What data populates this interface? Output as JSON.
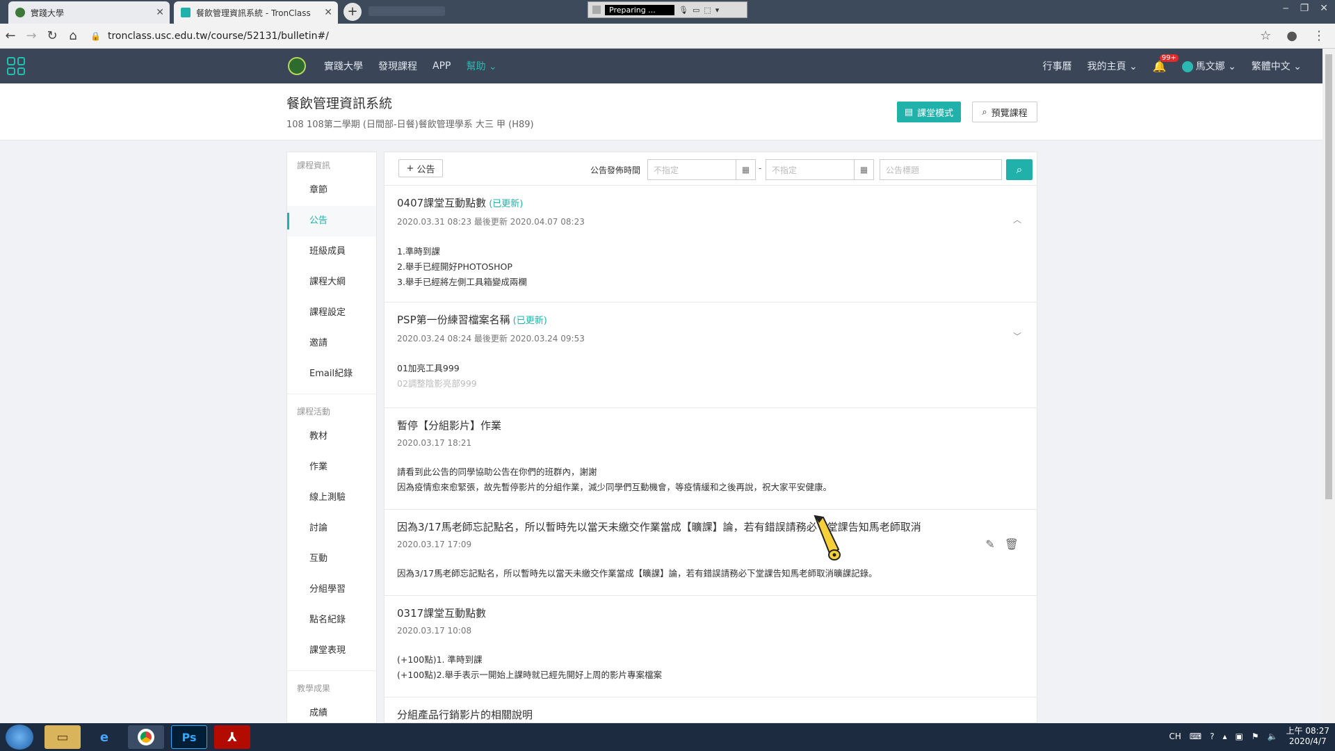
{
  "browser": {
    "tabs": [
      {
        "label": "實踐大學"
      },
      {
        "label": "餐飲管理資訊系統 - TronClass"
      }
    ],
    "recorder_status": "Preparing ...",
    "url": "tronclass.usc.edu.tw/course/52131/bulletin#/"
  },
  "header": {
    "nav": [
      "實踐大學",
      "發現課程",
      "APP",
      "幫助"
    ],
    "right": {
      "calendar": "行事曆",
      "my_home": "我的主頁",
      "notif_count": "99+",
      "user": "馬文娜",
      "language": "繁體中文"
    }
  },
  "course": {
    "title": "餐飲管理資訊系統",
    "subtitle": "108 108第二學期 (日間部-日餐)餐飲管理學系 大三 甲 (H89)",
    "btn_classroom": "課堂模式",
    "btn_preview": "預覽課程"
  },
  "sidebar": {
    "sections": [
      {
        "title": "課程資訊",
        "items": [
          "章節",
          "公告",
          "班級成員",
          "課程大綱",
          "課程設定",
          "邀請",
          "Email紀錄"
        ]
      },
      {
        "title": "課程活動",
        "items": [
          "教材",
          "作業",
          "線上測驗",
          "討論",
          "互動",
          "分組學習",
          "點名紀錄",
          "課堂表現"
        ]
      },
      {
        "title": "教學成果",
        "items": [
          "成績"
        ]
      }
    ],
    "active": "公告"
  },
  "toolbar": {
    "add_label": "公告",
    "filter_label": "公告發佈時間",
    "date_from_placeholder": "不指定",
    "date_to_placeholder": "不指定",
    "title_placeholder": "公告標題"
  },
  "posts": [
    {
      "title": "0407課堂互動點數",
      "updated": "(已更新)",
      "meta": "2020.03.31 08:23 最後更新 2020.04.07 08:23",
      "body": [
        "1.準時到課",
        "2.舉手已經開好PHOTOSHOP",
        "3.舉手已經將左側工具箱變成兩欄"
      ]
    },
    {
      "title": "PSP第一份練習檔案名稱",
      "updated": "(已更新)",
      "meta": "2020.03.24 08:24 最後更新 2020.03.24 09:53",
      "body": [
        "01加亮工具999",
        "02調整陰影亮部999"
      ]
    },
    {
      "title": "暫停【分組影片】作業",
      "updated": "",
      "meta": "2020.03.17 18:21",
      "body": [
        "請看到此公告的同學協助公告在你們的班群內，謝謝",
        "因為疫情愈來愈緊張，故先暫停影片的分組作業，減少同學們互動機會，等疫情緩和之後再說，祝大家平安健康。"
      ]
    },
    {
      "title": "因為3/17馬老師忘記點名，所以暫時先以當天未繳交作業當成【曠課】論，若有錯誤請務必下堂課告知馬老師取消",
      "updated": "",
      "meta": "2020.03.17 17:09",
      "body": [
        "因為3/17馬老師忘記點名，所以暫時先以當天未繳交作業當成【曠課】論，若有錯誤請務必下堂課告知馬老師取消曠課記錄。"
      ]
    },
    {
      "title": "0317課堂互動點數",
      "updated": "",
      "meta": "2020.03.17 10:08",
      "body": [
        "(+100點)1. 準時到課",
        "(+100點)2.舉手表示一開始上課時就已經先開好上周的影片專案檔案"
      ]
    },
    {
      "title": "分組產品行銷影片的相關說明",
      "updated": "",
      "meta": "",
      "body": []
    }
  ],
  "taskbar": {
    "lang": "CH",
    "time": "上午 08:27",
    "date": "2020/4/7"
  }
}
